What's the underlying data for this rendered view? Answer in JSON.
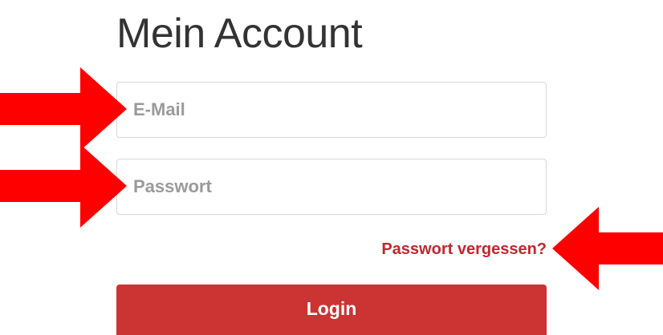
{
  "account": {
    "title": "Mein Account"
  },
  "form": {
    "email_placeholder": "E-Mail",
    "password_placeholder": "Passwort",
    "forgot_password_label": "Passwort vergessen?",
    "login_label": "Login"
  },
  "annotations": {
    "arrow_color": "#ff0000"
  },
  "colors": {
    "brand_red": "#cc3333",
    "link_red": "#c1272d"
  }
}
